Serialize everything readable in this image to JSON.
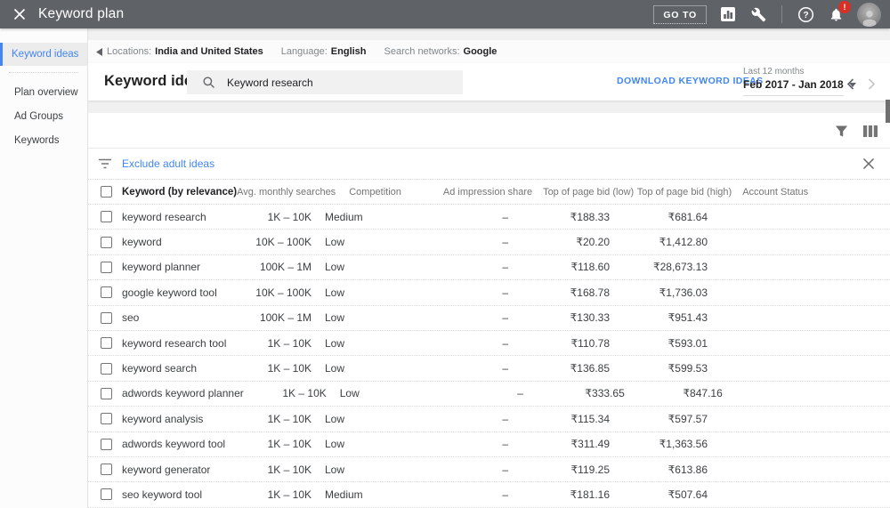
{
  "topbar": {
    "title": "Keyword plan",
    "goto_label": "GO TO",
    "notification_badge": "!"
  },
  "icons": {
    "close": "x-cross",
    "reports": "bar-chart-in-square",
    "tools": "wrench",
    "help": "question-mark-circle",
    "notifications": "bell-with-badge",
    "search": "magnifier",
    "filter": "funnel",
    "columns": "three-vertical-bars",
    "filter_list": "three-decreasing-lines",
    "collapse": "left-triangle"
  },
  "sidebar": {
    "items": [
      {
        "label": "Keyword ideas",
        "selected": true
      },
      {
        "label": "Plan overview",
        "selected": false
      },
      {
        "label": "Ad Groups",
        "selected": false
      },
      {
        "label": "Keywords",
        "selected": false
      }
    ]
  },
  "settings_bar": {
    "locations_label": "Locations:",
    "locations_value": "India and United States",
    "language_label": "Language:",
    "language_value": "English",
    "networks_label": "Search networks:",
    "networks_value": "Google"
  },
  "header": {
    "title": "Keyword ideas",
    "search_value": "Keyword research",
    "download_label": "DOWNLOAD KEYWORD IDEAS",
    "date_range_label": "Last 12 months",
    "date_range_value": "Feb 2017 - Jan 2018"
  },
  "filters": {
    "exclude_label": "Exclude adult ideas"
  },
  "table": {
    "columns": [
      "Keyword (by relevance)",
      "Avg. monthly searches",
      "Competition",
      "Ad impression share",
      "Top of page bid (low)",
      "Top of page bid (high)",
      "Account Status"
    ],
    "rows": [
      {
        "keyword": "keyword research",
        "searches": "1K – 10K",
        "competition": "Medium",
        "ad_impression_share": "–",
        "bid_low": "₹188.33",
        "bid_high": "₹681.64",
        "account_status": ""
      },
      {
        "keyword": "keyword",
        "searches": "10K – 100K",
        "competition": "Low",
        "ad_impression_share": "–",
        "bid_low": "₹20.20",
        "bid_high": "₹1,412.80",
        "account_status": ""
      },
      {
        "keyword": "keyword planner",
        "searches": "100K – 1M",
        "competition": "Low",
        "ad_impression_share": "–",
        "bid_low": "₹118.60",
        "bid_high": "₹28,673.13",
        "account_status": ""
      },
      {
        "keyword": "google keyword tool",
        "searches": "10K – 100K",
        "competition": "Low",
        "ad_impression_share": "–",
        "bid_low": "₹168.78",
        "bid_high": "₹1,736.03",
        "account_status": ""
      },
      {
        "keyword": "seo",
        "searches": "100K – 1M",
        "competition": "Low",
        "ad_impression_share": "–",
        "bid_low": "₹130.33",
        "bid_high": "₹951.43",
        "account_status": ""
      },
      {
        "keyword": "keyword research tool",
        "searches": "1K – 10K",
        "competition": "Low",
        "ad_impression_share": "–",
        "bid_low": "₹110.78",
        "bid_high": "₹593.01",
        "account_status": ""
      },
      {
        "keyword": "keyword search",
        "searches": "1K – 10K",
        "competition": "Low",
        "ad_impression_share": "–",
        "bid_low": "₹136.85",
        "bid_high": "₹599.53",
        "account_status": ""
      },
      {
        "keyword": "adwords keyword planner",
        "searches": "1K – 10K",
        "competition": "Low",
        "ad_impression_share": "–",
        "bid_low": "₹333.65",
        "bid_high": "₹847.16",
        "account_status": ""
      },
      {
        "keyword": "keyword analysis",
        "searches": "1K – 10K",
        "competition": "Low",
        "ad_impression_share": "–",
        "bid_low": "₹115.34",
        "bid_high": "₹597.57",
        "account_status": ""
      },
      {
        "keyword": "adwords keyword tool",
        "searches": "1K – 10K",
        "competition": "Low",
        "ad_impression_share": "–",
        "bid_low": "₹311.49",
        "bid_high": "₹1,363.56",
        "account_status": ""
      },
      {
        "keyword": "keyword generator",
        "searches": "1K – 10K",
        "competition": "Low",
        "ad_impression_share": "–",
        "bid_low": "₹119.25",
        "bid_high": "₹613.86",
        "account_status": ""
      },
      {
        "keyword": "seo keyword tool",
        "searches": "1K – 10K",
        "competition": "Medium",
        "ad_impression_share": "–",
        "bid_low": "₹181.16",
        "bid_high": "₹507.64",
        "account_status": ""
      }
    ]
  },
  "colors": {
    "topbar_bg": "#5f6368",
    "accent_blue": "#4285f4",
    "badge_red": "#d93025",
    "text_primary": "#212121",
    "text_secondary": "#757575"
  }
}
